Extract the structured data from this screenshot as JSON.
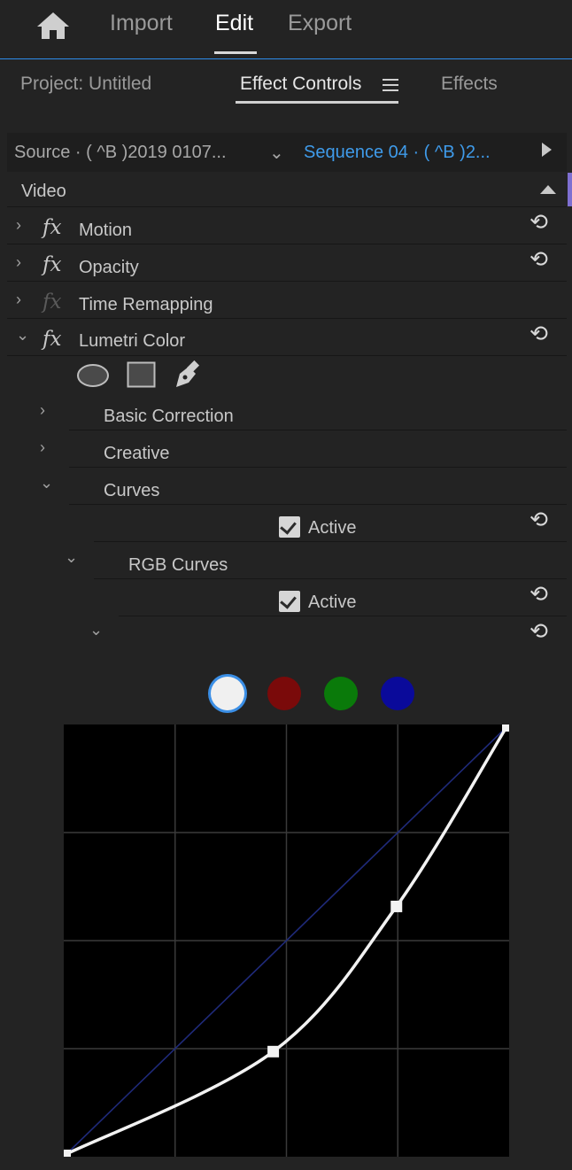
{
  "workspace": {
    "home_icon": "home-icon",
    "tabs": [
      "Import",
      "Edit",
      "Export"
    ],
    "active_tab": "Edit"
  },
  "panel_tabs": [
    "Project: Untitled",
    "Effect Controls",
    "Effects"
  ],
  "panel_menu_icon": "hamburger-menu-icon",
  "source_bar": {
    "source": "Source · ( ^B )2019 0107...",
    "sequence": "Sequence 04 · ( ^B )2..."
  },
  "video_header": "Video",
  "effects": [
    {
      "name": "Motion"
    },
    {
      "name": "Opacity"
    },
    {
      "name": "Time Remapping"
    },
    {
      "name": "Lumetri Color"
    }
  ],
  "fx_symbol": "fx",
  "mask_tools": [
    "ellipse-mask-icon",
    "rectangle-mask-icon",
    "pen-mask-icon"
  ],
  "lumetri_sections": [
    "Basic Correction",
    "Creative",
    "Curves"
  ],
  "curves": {
    "active_label": "Active",
    "active_checked": true,
    "rgb_curves": "RGB Curves",
    "rgb_active_label": "Active",
    "rgb_active_checked": true,
    "channels": [
      {
        "name": "white",
        "color": "#f0f0f0",
        "selected": true
      },
      {
        "name": "red",
        "color": "#7a0a0a",
        "selected": false
      },
      {
        "name": "green",
        "color": "#0a7a0a",
        "selected": false
      },
      {
        "name": "blue",
        "color": "#0a0a9a",
        "selected": false
      }
    ],
    "control_points": [
      {
        "input": 0.0,
        "output": 0.0
      },
      {
        "input": 0.47,
        "output": 0.24
      },
      {
        "input": 0.75,
        "output": 0.58
      },
      {
        "input": 1.0,
        "output": 1.0
      }
    ]
  },
  "colors": {
    "accent": "#2d8ceb",
    "sequence_text": "#3f9bea",
    "scroll_accent": "#7e6fd1"
  }
}
